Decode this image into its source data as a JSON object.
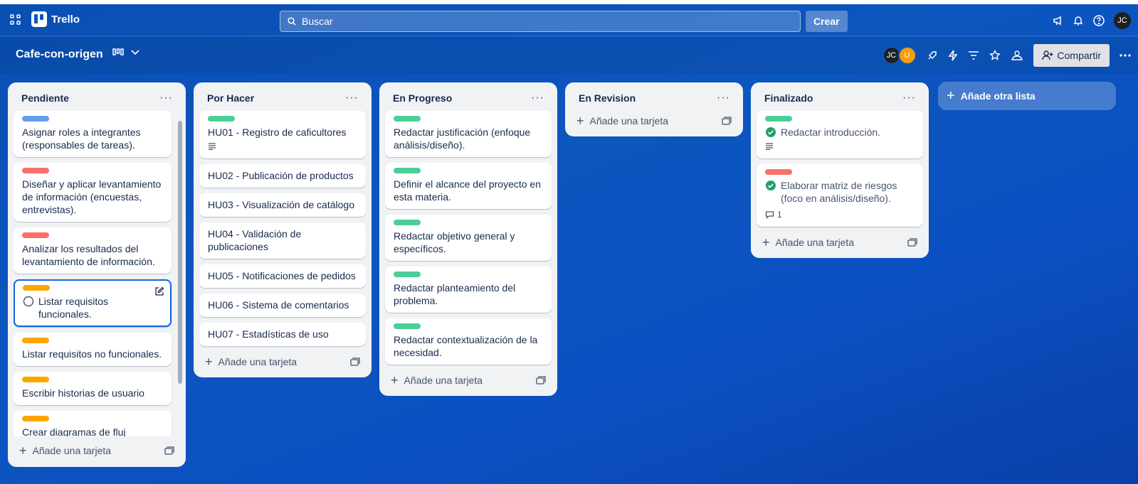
{
  "app": {
    "name": "Trello"
  },
  "search": {
    "placeholder": "Buscar"
  },
  "nav": {
    "create_label": "Crear",
    "avatar_initials": "JC"
  },
  "board": {
    "title": "Cafe-con-origen",
    "members": [
      "JC",
      "U"
    ],
    "share_label": "Compartir"
  },
  "colors": {
    "green": "#4bce97",
    "red": "#f87168",
    "orange": "#fca700",
    "blue": "#669df1"
  },
  "lists": [
    {
      "title": "Pendiente",
      "add_label": "Añade una tarjeta",
      "cards": [
        {
          "label": "blue",
          "text": "Asignar roles a integrantes (responsables de tareas)."
        },
        {
          "label": "red",
          "text": "Diseñar y aplicar levantamiento de información (encuestas, entrevistas)."
        },
        {
          "label": "red",
          "text": "Analizar los resultados del levantamiento de información."
        },
        {
          "label": "orange",
          "text": "Listar requisitos funcionales."
        },
        {
          "label": "orange",
          "text": "Listar requisitos no funcionales."
        },
        {
          "label": "orange",
          "text": "Escribir historias de usuario"
        },
        {
          "label": "orange",
          "text": "Crear diagramas de fluj"
        }
      ]
    },
    {
      "title": "Por Hacer",
      "add_label": "Añade una tarjeta",
      "cards": [
        {
          "label": "green",
          "text": "HU01 - Registro de caficultores"
        },
        {
          "text": "HU02 - Publicación de productos"
        },
        {
          "text": "HU03 - Visualización de catálogo"
        },
        {
          "text": "HU04 - Validación de publicaciones"
        },
        {
          "text": "HU05 - Notificaciones de pedidos"
        },
        {
          "text": "HU06 - Sistema de comentarios"
        },
        {
          "text": "HU07 - Estadísticas de uso"
        }
      ]
    },
    {
      "title": "En Progreso",
      "add_label": "Añade una tarjeta",
      "cards": [
        {
          "label": "green",
          "text": "Redactar justificación (enfoque análisis/diseño)."
        },
        {
          "label": "green",
          "text": "Definir el alcance del proyecto en esta materia."
        },
        {
          "label": "green",
          "text": "Redactar objetivo general y específicos."
        },
        {
          "label": "green",
          "text": "Redactar planteamiento del problema."
        },
        {
          "label": "green",
          "text": "Redactar contextualización de la necesidad."
        }
      ]
    },
    {
      "title": "En Revision",
      "add_label": "Añade una tarjeta",
      "cards": []
    },
    {
      "title": "Finalizado",
      "add_label": "Añade una tarjeta",
      "cards": [
        {
          "label": "green",
          "text": "Redactar introducción."
        },
        {
          "label": "red",
          "text": "Elaborar matriz de riesgos (foco en análisis/diseño).",
          "comments": "1"
        }
      ]
    }
  ],
  "add_list_label": "Añade otra lista"
}
